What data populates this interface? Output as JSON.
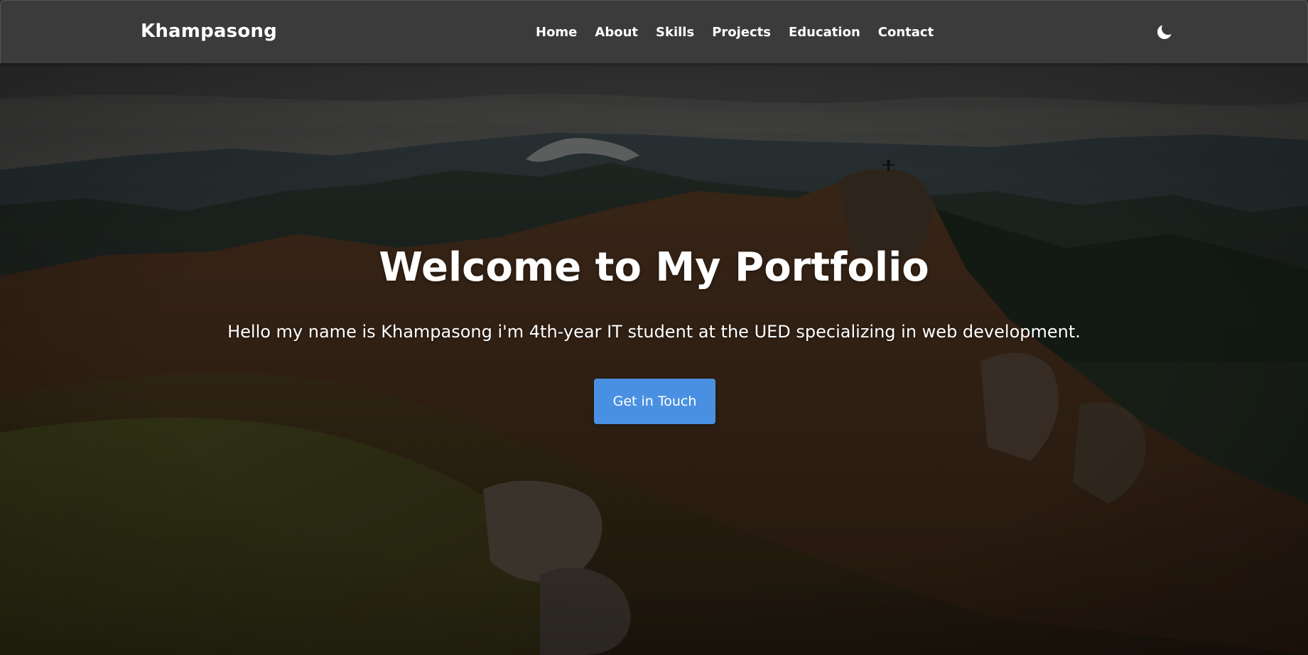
{
  "navbar": {
    "brand": "Khampasong",
    "links": [
      {
        "label": "Home"
      },
      {
        "label": "About"
      },
      {
        "label": "Skills"
      },
      {
        "label": "Projects"
      },
      {
        "label": "Education"
      },
      {
        "label": "Contact"
      }
    ],
    "theme_toggle_icon": "moon-icon"
  },
  "hero": {
    "title": "Welcome to My Portfolio",
    "subtitle": "Hello my name is Khampasong i'm 4th-year IT student at the UED specializing in web development.",
    "cta_label": "Get in Touch",
    "background": "mountain-landscape-photo"
  },
  "colors": {
    "navbar_bg": "#3b3b3b",
    "accent": "#4a90e2",
    "text": "#ffffff"
  }
}
